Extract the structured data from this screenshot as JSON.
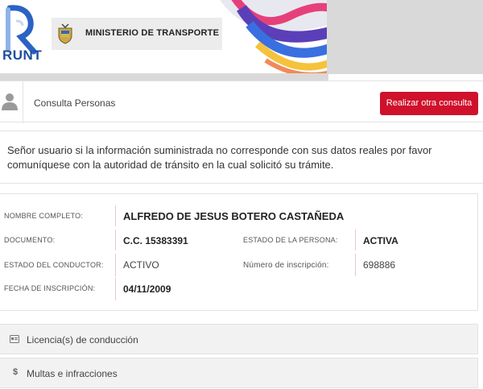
{
  "header": {
    "logo_text": "RUNT",
    "ministry_label": "MINISTERIO DE TRANSPORTE"
  },
  "topbar": {
    "title": "Consulta Personas",
    "action_button": "Realizar otra consulta"
  },
  "notice": {
    "text": "Señor usuario si la información suministrada no corresponde con sus datos reales por favor comuníquese con la autoridad de tránsito en la cual solicitó su trámite."
  },
  "person": {
    "nombre_label": "NOMBRE COMPLETO:",
    "nombre_value": "ALFREDO DE JESUS BOTERO CASTAÑEDA",
    "documento_label": "DOCUMENTO:",
    "documento_value": "C.C. 15383391",
    "estado_persona_label": "ESTADO DE LA PERSONA:",
    "estado_persona_value": "ACTIVA",
    "estado_conductor_label": "ESTADO DEL CONDUCTOR:",
    "estado_conductor_value": "ACTIVO",
    "numero_inscripcion_label": "Número de inscripción:",
    "numero_inscripcion_value": "698886",
    "fecha_inscripcion_label": "FECHA DE INSCRIPCIÓN:",
    "fecha_inscripcion_value": "04/11/2009"
  },
  "sections": [
    {
      "label": "Licencia(s) de conducción",
      "icon": "license-card-icon"
    },
    {
      "label": "Multas e infracciones",
      "icon": "dollar-icon",
      "icon_glyph": "$"
    }
  ],
  "colors": {
    "accent_red": "#d0112b",
    "runt_blue": "#1f4e9b"
  }
}
